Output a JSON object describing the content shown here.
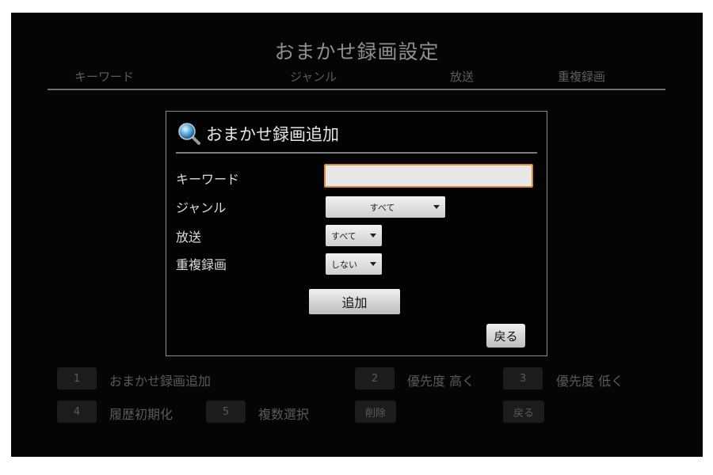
{
  "screen": {
    "title": "おまかせ録画設定",
    "columns": [
      {
        "label": "キーワード"
      },
      {
        "label": "ジャンル"
      },
      {
        "label": "放送"
      },
      {
        "label": "重複録画"
      }
    ]
  },
  "dialog": {
    "title": "おまかせ録画追加",
    "title_icon": "search-icon",
    "fields": {
      "keyword": {
        "label": "キーワード",
        "value": ""
      },
      "genre": {
        "label": "ジャンル",
        "selected": "すべて"
      },
      "broadcast": {
        "label": "放送",
        "selected": "すべて"
      },
      "duplicate": {
        "label": "重複録画",
        "selected": "しない"
      }
    },
    "add_label": "追加",
    "back_label": "戻る"
  },
  "keybar": {
    "row1": [
      {
        "key": "1",
        "label": "おまかせ録画追加"
      },
      {
        "key": "2",
        "label": "優先度 高く"
      },
      {
        "key": "3",
        "label": "優先度 低く"
      }
    ],
    "row2": [
      {
        "key": "4",
        "label": "履歴初期化"
      },
      {
        "key": "5",
        "label": "複数選択"
      },
      {
        "key": "削除",
        "label": ""
      },
      {
        "key": "戻る",
        "label": ""
      }
    ]
  },
  "colors": {
    "background": "#060505",
    "input_focus": "#e08a2a",
    "dim_text": "#5a5a5a"
  }
}
